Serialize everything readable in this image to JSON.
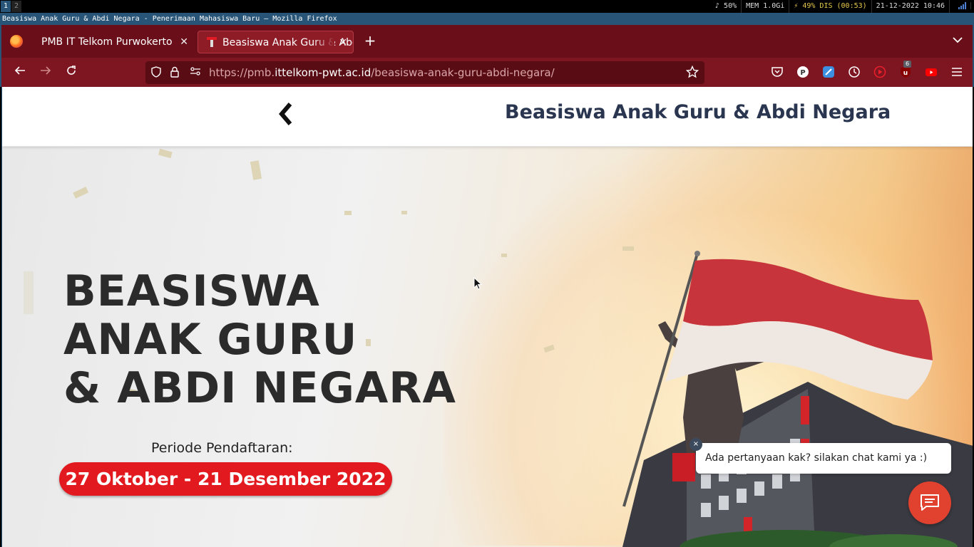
{
  "wm": {
    "workspaces": [
      "1",
      "2"
    ],
    "volume": "♪ 50%",
    "memory": "MEM 1.0Gi",
    "battery": "⚡ 49% DIS (00:53)",
    "datetime": "21-12-2022 10:46"
  },
  "window_title": "Beasiswa Anak Guru & Abdi Negara - Penerimaan Mahasiswa Baru — Mozilla Firefox",
  "browser": {
    "tabs": [
      {
        "label": "PMB IT Telkom Purwokerto",
        "active": false
      },
      {
        "label": "Beasiswa Anak Guru & Abdi Negara",
        "active": true
      }
    ],
    "url_prefix": "https://pmb.",
    "url_host": "ittelkom-pwt.ac.id",
    "url_path": "/beasiswa-anak-guru-abdi-negara/",
    "badge_count": "6"
  },
  "page": {
    "title": "Beasiswa Anak Guru & Abdi Negara",
    "banner": {
      "line1": "BEASISWA",
      "line2": "ANAK GURU",
      "line3": "& ABDI NEGARA",
      "periode_label": "Periode Pendaftaran:",
      "periode_dates": "27 Oktober - 21 Desember 2022"
    }
  },
  "chat": {
    "message": "Ada pertanyaan kak? silakan chat kami ya :)",
    "close_icon": "×"
  },
  "colors": {
    "tabbar": "#6a0f19",
    "navbar": "#7e1621",
    "title_text": "#2a3550",
    "date_pill": "#e21a1f",
    "chat_button": "#e1412f",
    "i3_focused": "#285577"
  }
}
